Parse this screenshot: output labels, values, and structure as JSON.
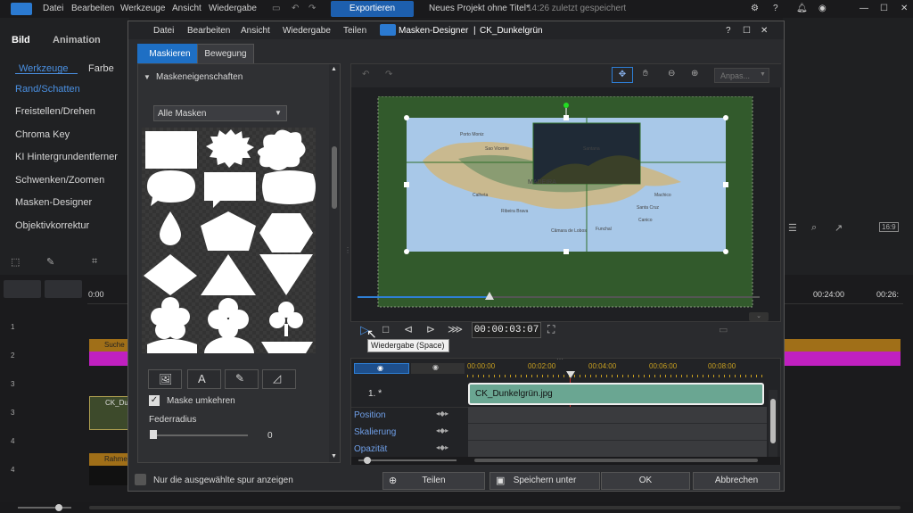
{
  "menu": {
    "items": [
      "Datei",
      "Bearbeiten",
      "Werkzeuge",
      "Ansicht",
      "Wiedergabe"
    ],
    "export_label": "Exportieren",
    "project_title": "Neues Projekt ohne Titel*",
    "saved_note": "14:26 zuletzt gespeichert"
  },
  "left_panel": {
    "tab_bild": "Bild",
    "tab_animation": "Animation",
    "sub_werkzeuge": "Werkzeuge",
    "sub_farbe": "Farbe",
    "items": [
      "Rand/Schatten",
      "Freistellen/Drehen",
      "Chroma Key",
      "KI Hintergrundentferner",
      "Schwenken/Zoomen",
      "Masken-Designer",
      "Objektivkorrektur"
    ]
  },
  "timeline": {
    "time_start": "0:00",
    "time_24": "00:24:00",
    "time_26": "00:26:",
    "clips": {
      "c2": "Suche",
      "c3": "CK_Du",
      "c5": "Rahme"
    },
    "tracks": [
      "1",
      "2",
      "3",
      "3",
      "4",
      "4"
    ]
  },
  "dialog": {
    "menu": [
      "Datei",
      "Bearbeiten",
      "Ansicht",
      "Wiedergabe",
      "Teilen"
    ],
    "title": "Masken-Designer",
    "subtitle": "CK_Dunkelgrün",
    "tabs": [
      "Maskieren",
      "Bewegung"
    ],
    "section_title": "Maskeneigenschaften",
    "mask_filter": "Alle Masken",
    "invert_label": "Maske umkehren",
    "invert_checked": true,
    "feather_label": "Federradius",
    "feather_value": "0",
    "aspect_label": "Anpas...",
    "map_labels": [
      "Porto Moniz",
      "Sao Vicente",
      "Santana",
      "MADEIRA",
      "Machico",
      "Calheta",
      "Ribeira Brava",
      "Santa Cruz",
      "Câmara de Lobos",
      "Funchal",
      "Canico"
    ],
    "timecode": "00:00:03:07",
    "tooltip": "Wiedergabe (Space)",
    "ruler": [
      "00:00:00",
      "00:02:00",
      "00:04:00",
      "00:06:00",
      "00:08:00"
    ],
    "track_name": "1.",
    "clip_name": "CK_Dunkelgrün.jpg",
    "keyframe_rows": [
      "Position",
      "Skalierung",
      "Opazität"
    ],
    "only_selected": "Nur die ausgewählte spur anzeigen",
    "buttons": {
      "share": "Teilen",
      "save_as": "Speichern unter",
      "ok": "OK",
      "cancel": "Abbrechen"
    }
  },
  "colors": {
    "accent": "#2e7fd6",
    "green_bg": "#325a2c",
    "playhead": "#d0342c",
    "clip": "#6aa692",
    "magenta": "#c020c0"
  },
  "playback": {
    "progress": 0.41
  }
}
